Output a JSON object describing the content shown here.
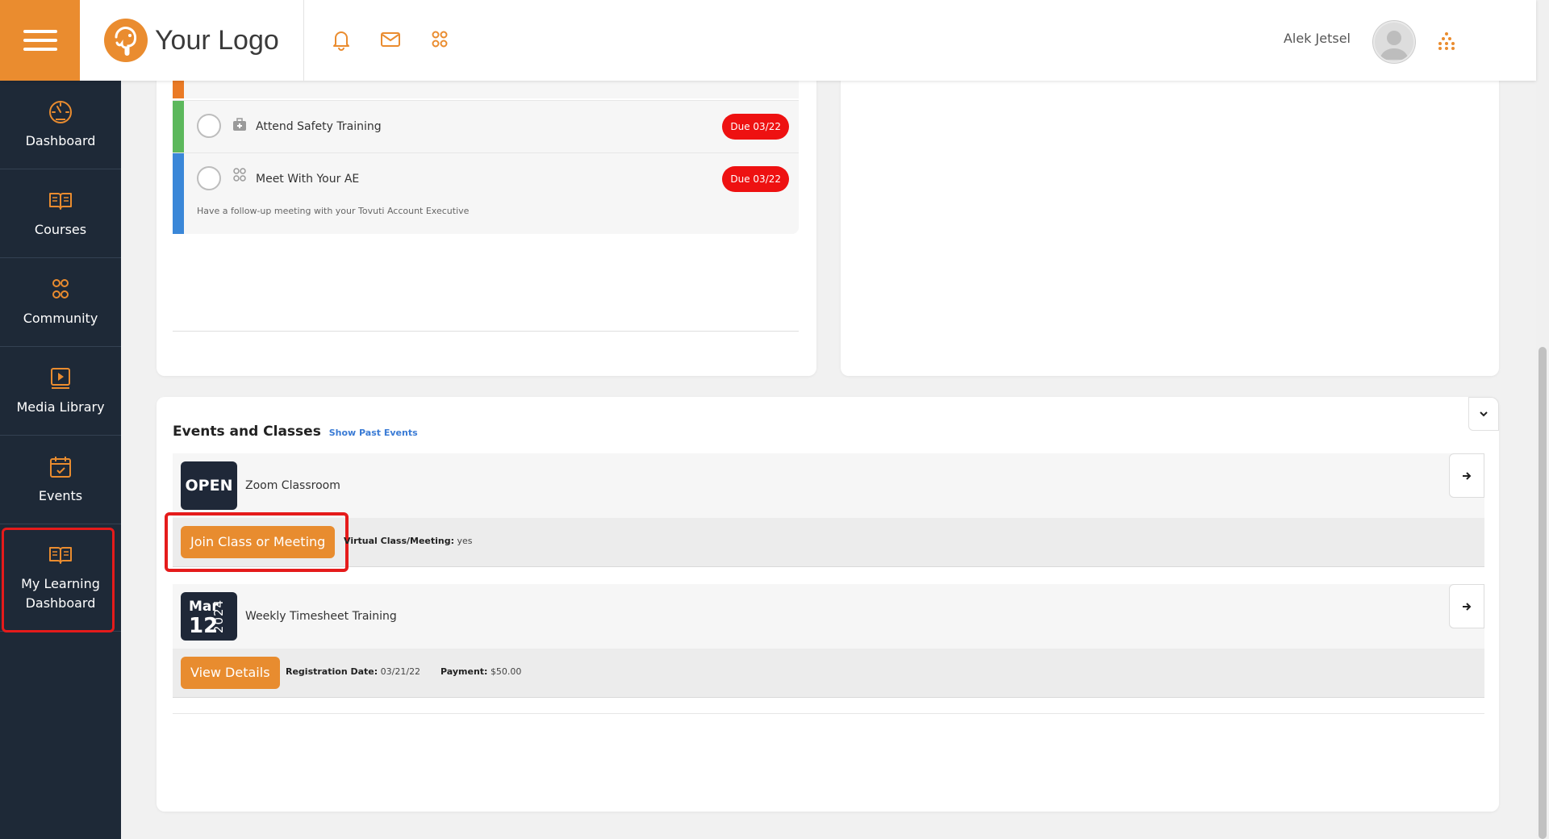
{
  "header": {
    "logo_text": "Your Logo",
    "user_name": "Alek Jetsel"
  },
  "sidebar": {
    "items": [
      {
        "label": "Dashboard",
        "icon": "dashboard-gauge-icon"
      },
      {
        "label": "Courses",
        "icon": "open-book-icon"
      },
      {
        "label": "Community",
        "icon": "community-people-icon"
      },
      {
        "label": "Media Library",
        "icon": "media-library-icon"
      },
      {
        "label": "Events",
        "icon": "calendar-icon"
      },
      {
        "label": "My Learning\nDashboard",
        "icon": "open-book-icon"
      }
    ]
  },
  "tasks": [
    {
      "title": "Attend Safety Training",
      "due": "Due 03/22",
      "color": "#5cb85c",
      "icon": "medical-kit-icon"
    },
    {
      "title": "Meet With Your AE",
      "due": "Due 03/22",
      "color": "#3a87d8",
      "icon": "people-icon",
      "description": "Have a follow-up meeting with your Tovuti Account Executive"
    }
  ],
  "events_section": {
    "title": "Events and Classes",
    "show_past_link": "Show Past Events",
    "events": [
      {
        "badge": "OPEN",
        "name": "Zoom Classroom",
        "button": "Join Class or Meeting",
        "meta_label": "Virtual Class/Meeting:",
        "meta_value": "yes"
      },
      {
        "month": "Mar",
        "day": "12",
        "year": "2024",
        "name": "Weekly Timesheet Training",
        "button": "View Details",
        "reg_label": "Registration Date:",
        "reg_value": "03/21/22",
        "pay_label": "Payment:",
        "pay_value": "$50.00"
      }
    ]
  },
  "colors": {
    "accent": "#ea8c2f",
    "sidebar_bg": "#1e2937",
    "due_red": "#ee1111",
    "annotation_red": "#e51b1b"
  }
}
